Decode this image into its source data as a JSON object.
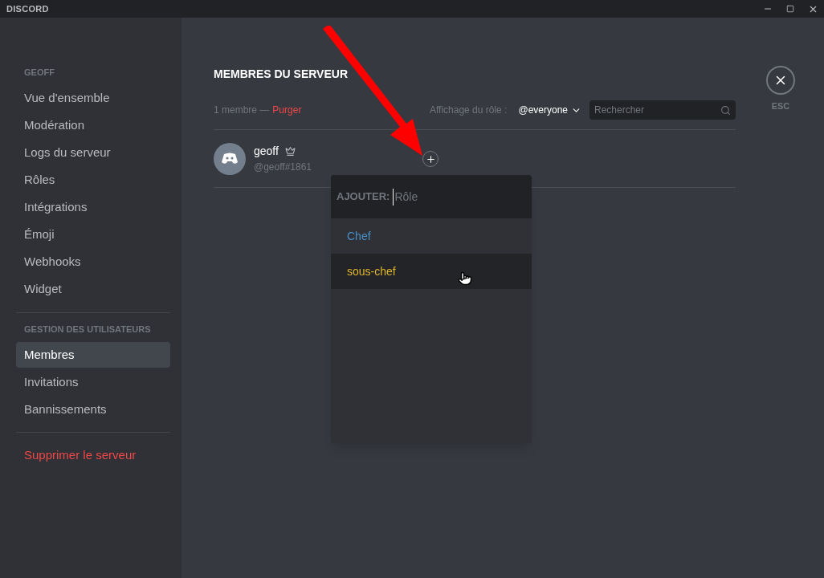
{
  "window": {
    "title": "DISCORD"
  },
  "sidebar": {
    "sections": [
      {
        "heading": "GEOFF",
        "items": [
          {
            "label": "Vue d'ensemble",
            "selected": false,
            "kind": "normal"
          },
          {
            "label": "Modération",
            "selected": false,
            "kind": "normal"
          },
          {
            "label": "Logs du serveur",
            "selected": false,
            "kind": "normal"
          },
          {
            "label": "Rôles",
            "selected": false,
            "kind": "normal"
          },
          {
            "label": "Intégrations",
            "selected": false,
            "kind": "normal"
          },
          {
            "label": "Émoji",
            "selected": false,
            "kind": "normal"
          },
          {
            "label": "Webhooks",
            "selected": false,
            "kind": "normal"
          },
          {
            "label": "Widget",
            "selected": false,
            "kind": "normal"
          }
        ]
      },
      {
        "heading": "GESTION DES UTILISATEURS",
        "items": [
          {
            "label": "Membres",
            "selected": true,
            "kind": "normal"
          },
          {
            "label": "Invitations",
            "selected": false,
            "kind": "normal"
          },
          {
            "label": "Bannissements",
            "selected": false,
            "kind": "normal"
          }
        ]
      },
      {
        "items": [
          {
            "label": "Supprimer le serveur",
            "selected": false,
            "kind": "danger"
          }
        ]
      }
    ]
  },
  "main": {
    "title": "MEMBRES DU SERVEUR",
    "member_count": "1 membre —",
    "purge_link": "Purger",
    "role_display_label": "Affichage du rôle :",
    "role_display_value": "@everyone",
    "search": {
      "placeholder": "Rechercher"
    },
    "members": [
      {
        "name": "geoff",
        "tag": "@geoff#1861"
      }
    ],
    "add_role_popup": {
      "label": "AJOUTER:",
      "placeholder": "Rôle",
      "roles": [
        {
          "name": "Chef",
          "color": "#4a90c8",
          "hovered": false
        },
        {
          "name": "sous-chef",
          "color": "#e0b52a",
          "hovered": true
        }
      ]
    },
    "close": {
      "label": "ESC"
    }
  }
}
